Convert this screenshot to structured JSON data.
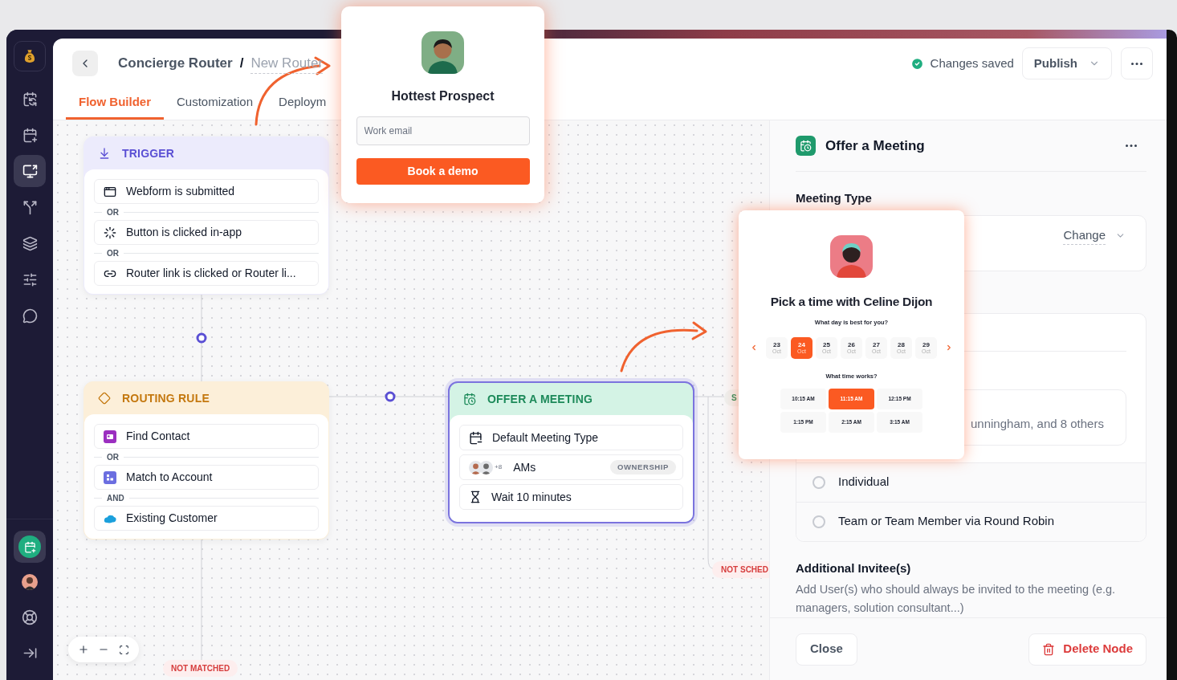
{
  "sidebar": {
    "items": [
      {
        "selected": false
      },
      {
        "selected": false
      },
      {
        "selected": true
      },
      {
        "selected": false
      },
      {
        "selected": false
      },
      {
        "selected": false
      },
      {
        "selected": false
      }
    ],
    "bottom_items": [
      {
        "kind": "app",
        "selected": true
      },
      {
        "kind": "avatar",
        "selected": false
      },
      {
        "kind": "help",
        "selected": false
      },
      {
        "kind": "collapse",
        "selected": false
      }
    ]
  },
  "header": {
    "breadcrumb": [
      "Concierge Router",
      "New Router"
    ],
    "separator": "/",
    "status": "Changes saved",
    "publish": "Publish"
  },
  "tabs": [
    {
      "label": "Flow Builder",
      "selected": true
    },
    {
      "label": "Customization",
      "selected": false
    },
    {
      "label": "Deploym",
      "selected": false
    }
  ],
  "nodes": [
    {
      "kind": "trigger",
      "title": "TRIGGER",
      "selected": false,
      "items": [
        {
          "label": "Webform is submitted"
        },
        {
          "joiner": "OR",
          "label": "Button is clicked in-app"
        },
        {
          "joiner": "OR",
          "label": "Router link is clicked or Router li..."
        }
      ]
    },
    {
      "kind": "routing",
      "title": "ROUTING RULE",
      "selected": false,
      "items": [
        {
          "label": "Find Contact"
        },
        {
          "joiner": "OR",
          "label": "Match to Account"
        },
        {
          "joiner": "AND",
          "label": "Existing Customer"
        }
      ]
    },
    {
      "kind": "meeting",
      "title": "OFFER A MEETING",
      "selected": true,
      "items": [
        {
          "kind": "plain",
          "label": "Default Meeting Type"
        },
        {
          "kind": "team",
          "count": "+8",
          "label": "AMs",
          "tag": "OWNERSHIP"
        },
        {
          "kind": "plain",
          "label": "Wait 10 minutes"
        }
      ]
    }
  ],
  "edge_labels": [
    {
      "kind": "not_matched",
      "label": "NOT MATCHED"
    },
    {
      "kind": "scheduled",
      "label": "S"
    },
    {
      "kind": "not_scheduled",
      "label": "NOT SCHED"
    }
  ],
  "prospect_popup": {
    "name": "Hottest Prospect",
    "email_placeholder": "Work email",
    "button": "Book a demo"
  },
  "calendar_popup": {
    "title": "Pick a time with Celine Dijon",
    "day_prompt": "What day is best for you?",
    "days": [
      {
        "day": "23",
        "month": "Oct",
        "selected": false
      },
      {
        "day": "24",
        "month": "Oct",
        "selected": true
      },
      {
        "day": "25",
        "month": "Oct",
        "selected": false
      },
      {
        "day": "26",
        "month": "Oct",
        "selected": false
      },
      {
        "day": "27",
        "month": "Oct",
        "selected": false
      },
      {
        "day": "28",
        "month": "Oct",
        "selected": false
      },
      {
        "day": "29",
        "month": "Oct",
        "selected": false
      }
    ],
    "time_prompt": "What time works?",
    "times": [
      {
        "label": "10:15 AM",
        "selected": false
      },
      {
        "label": "11:15 AM",
        "selected": true
      },
      {
        "label": "12:15 PM",
        "selected": false
      },
      {
        "label": "1:15 PM",
        "selected": false
      },
      {
        "label": "2:15 AM",
        "selected": false
      },
      {
        "label": "3:15 AM",
        "selected": false
      }
    ]
  },
  "panel": {
    "title": "Offer a Meeting",
    "meeting_type_label": "Meeting Type",
    "change": "Change",
    "assignee_text": "unningham, and 8 others",
    "options": [
      {
        "label": "Individual",
        "selected": false
      },
      {
        "label": "Team or Team Member via Round Robin",
        "selected": false
      }
    ],
    "invitees_title": "Additional Invitee(s)",
    "invitees_desc": "Add User(s) who should always be invited to the meeting (e.g. managers, solution consultant...)",
    "close": "Close",
    "delete": "Delete Node"
  }
}
